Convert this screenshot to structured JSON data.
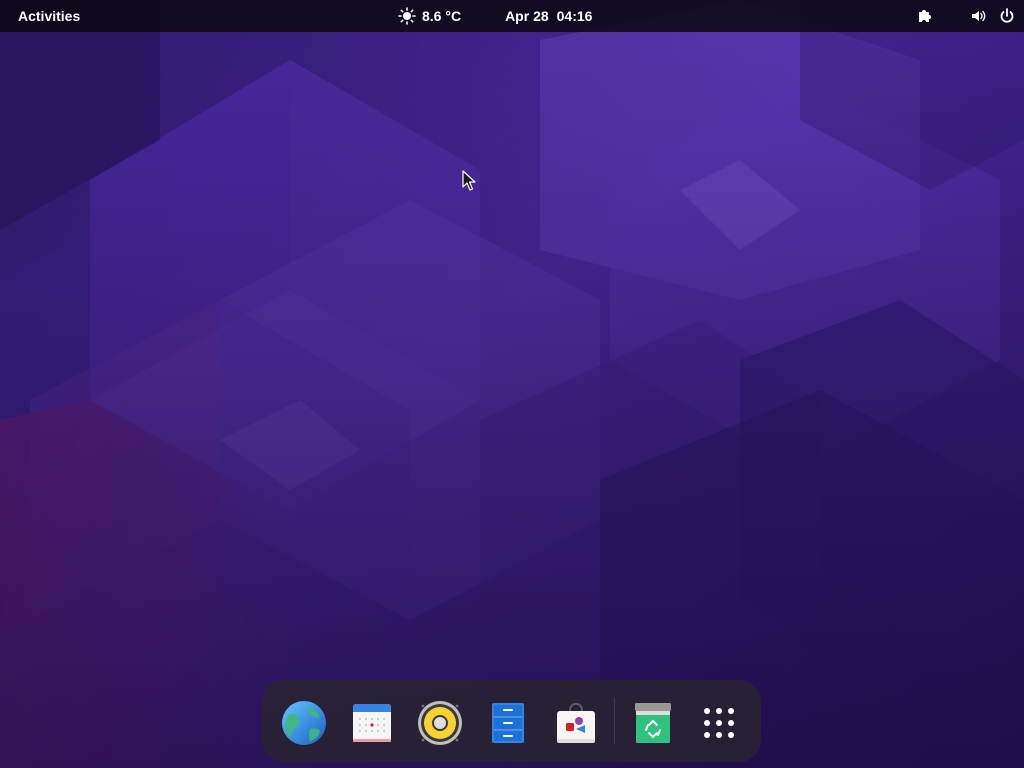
{
  "topbar": {
    "activities_label": "Activities",
    "weather": {
      "icon": "sun-icon",
      "temperature": "8.6 °C"
    },
    "date": "Apr 28",
    "time": "04:16",
    "tray": {
      "extensions_icon": "puzzle-icon",
      "volume_icon": "speaker-icon",
      "power_icon": "power-icon"
    }
  },
  "dock": {
    "apps": [
      {
        "name": "Web Browser",
        "icon": "globe-icon"
      },
      {
        "name": "Calendar",
        "icon": "calendar-icon"
      },
      {
        "name": "Rhythmbox",
        "icon": "music-speaker-icon"
      },
      {
        "name": "Files",
        "icon": "file-cabinet-icon"
      },
      {
        "name": "Software",
        "icon": "software-bag-icon"
      },
      {
        "name": "Trash",
        "icon": "trash-icon"
      },
      {
        "name": "Show Apps",
        "icon": "app-grid-icon"
      }
    ]
  },
  "colors": {
    "wallpaper_base": "#3b1d7a",
    "wallpaper_highlight": "#6a3fbf",
    "wallpaper_accent": "#7a2a8a",
    "topbar_bg": "#0c0814",
    "dock_bg": "#28242e"
  }
}
